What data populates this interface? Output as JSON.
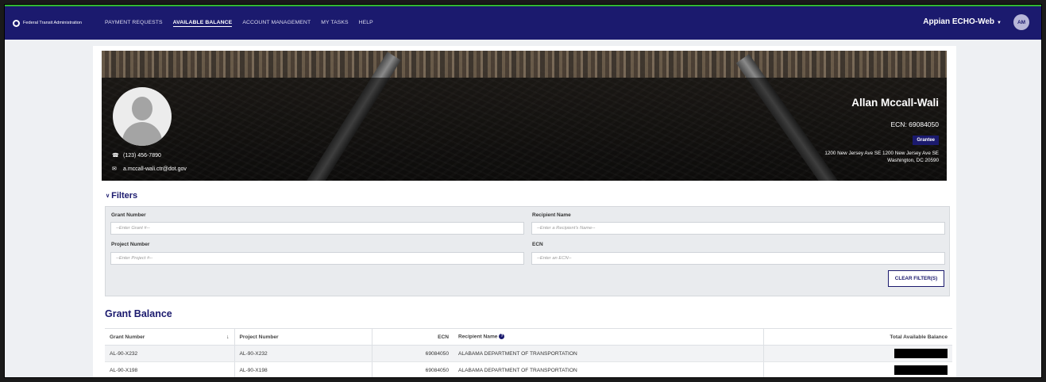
{
  "nav": {
    "brand": "Federal Transit Administration",
    "links": [
      "PAYMENT REQUESTS",
      "AVAILABLE BALANCE",
      "ACCOUNT MANAGEMENT",
      "MY TASKS",
      "HELP"
    ],
    "app_name": "Appian ECHO-Web",
    "avatar_initials": "AM"
  },
  "profile": {
    "name": "Allan Mccall-Wali",
    "ecn": "ECN: 69084050",
    "role": "Grantee",
    "address_line1": "1200 New Jersey Ave SE 1200 New Jersey Ave SE",
    "address_line2": "Washington, DC 20590",
    "phone": "(123) 456-7890",
    "email": "a.mccall-wali.ctr@dot.gov"
  },
  "filters": {
    "title": "Filters",
    "grant_number_label": "Grant Number",
    "grant_number_placeholder": "--Enter Grant #--",
    "recipient_name_label": "Recipient Name",
    "recipient_name_placeholder": "--Enter a Recipient's Name--",
    "project_number_label": "Project Number",
    "project_number_placeholder": "--Enter Project #--",
    "ecn_label": "ECN",
    "ecn_placeholder": "--Enter an ECN--",
    "clear_button": "CLEAR FILTER(S)"
  },
  "grant_balance": {
    "title": "Grant Balance",
    "columns": {
      "grant_number": "Grant Number",
      "project_number": "Project Number",
      "ecn": "ECN",
      "recipient_name": "Recipient Name",
      "total_available_balance": "Total Available Balance"
    },
    "rows": [
      {
        "grant_number": "AL-90-X232",
        "project_number": "AL-90-X232",
        "ecn": "69084050",
        "recipient_name": "ALABAMA DEPARTMENT OF TRANSPORTATION"
      },
      {
        "grant_number": "AL-90-X198",
        "project_number": "AL-90-X198",
        "ecn": "69084050",
        "recipient_name": "ALABAMA DEPARTMENT OF TRANSPORTATION"
      }
    ]
  },
  "colors": {
    "primary_navy": "#1b1a6e",
    "nav_accent_green": "#33b833"
  }
}
